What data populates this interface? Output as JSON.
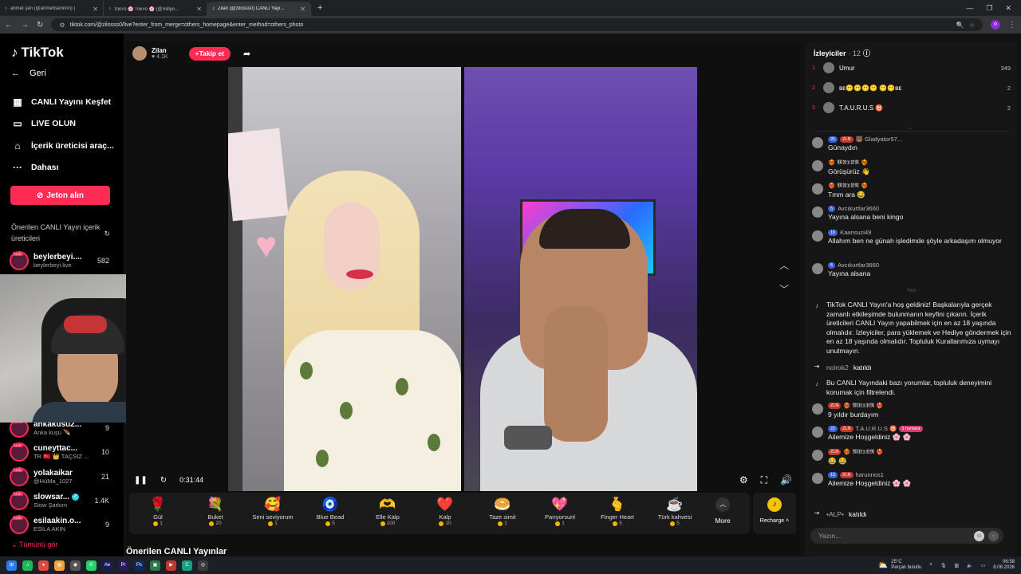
{
  "browser": {
    "tabs": [
      {
        "label": "ahmet şen (@ahmettsennnn) |",
        "active": false
      },
      {
        "label": "ᴛᴏᴋʏᴏ 🌸 ᴛᴏᴋʏᴏ 🌸 (@millyo...",
        "active": false
      },
      {
        "label": "Zilan (@zilosss0) CANLI Yayı...",
        "active": true
      }
    ],
    "url": "tiktok.com/@zilosss0/live?enter_from_merge=others_homepage&enter_method=others_photo"
  },
  "sidebar": {
    "logo": "TikTok",
    "back": "Geri",
    "nav": [
      {
        "label": "CANLI Yayını Keşfet",
        "icon": "calendar-icon"
      },
      {
        "label": "LIVE OLUN",
        "icon": "video-camera-icon"
      },
      {
        "label": "İçerik üreticisi araç...",
        "icon": "home-icon"
      },
      {
        "label": "Dahası",
        "icon": "more-dots-icon"
      }
    ],
    "coin_button": "Jeton alın",
    "suggested_title": "Önerilen CANLI Yayın içerik üreticileri",
    "creators_top": [
      {
        "name": "beylerbeyi....",
        "sub": "beylerbeyi.live",
        "count": "582"
      }
    ],
    "creators": [
      {
        "name": "ankakusu2...",
        "sub": "Anka kuşu 🪶",
        "count": "9"
      },
      {
        "name": "cuneyttac...",
        "sub": "TR 🇹🇷 👑 TAÇSIZ ...",
        "count": "10"
      },
      {
        "name": "yolakaikar",
        "sub": "@HüMa_1027",
        "count": "21"
      },
      {
        "name": "slowsar...",
        "sub": "Slow Şarkım",
        "count": "1.4K",
        "verified": true
      },
      {
        "name": "esilaakin.o...",
        "sub": "ESİLA AKIN",
        "count": "9"
      }
    ],
    "see_all": "Tümünü gör"
  },
  "stream": {
    "host_name": "Zilan",
    "host_likes": "4.1K",
    "follow": "Takip et",
    "time": "0:31:44",
    "gifts": [
      {
        "name": "Gül",
        "price": "1",
        "icon": "🌹"
      },
      {
        "name": "Buket",
        "price": "20",
        "icon": "💐"
      },
      {
        "name": "Seni seviyorum",
        "price": "1",
        "icon": "🥰"
      },
      {
        "name": "Blue Bead",
        "price": "5",
        "icon": "🧿"
      },
      {
        "name": "Elle Kalp",
        "price": "100",
        "icon": "🫶"
      },
      {
        "name": "Kalp",
        "price": "10",
        "icon": "❤️"
      },
      {
        "name": "Taze simit",
        "price": "1",
        "icon": "🥯"
      },
      {
        "name": "Parıyorsunl",
        "price": "1",
        "icon": "💖"
      },
      {
        "name": "Finger Heart",
        "price": "5",
        "icon": "🫰"
      },
      {
        "name": "Türk kahvesi",
        "price": "5",
        "icon": "☕"
      }
    ],
    "more": "More",
    "recharge": "Recharge",
    "recommended": "Önerilen CANLI Yayınlar"
  },
  "chat": {
    "viewers_label": "İzleyiciler",
    "viewers_count": "· 12",
    "top_viewers": [
      {
        "rank": "1",
        "name": "Umur",
        "value": "349"
      },
      {
        "rank": "2",
        "name": "ʙᴇ😶😶😶😶 😶😶ʙᴇ",
        "value": "2"
      },
      {
        "rank": "3",
        "name": "T.A.U.R.U.S ♉",
        "value": "2"
      }
    ],
    "messages": [
      {
        "badges": [
          {
            "t": "26",
            "c": "b-blue"
          },
          {
            "t": "ZLN",
            "c": "b-red"
          }
        ],
        "user": "🐻 Gladyator57...",
        "text": "Günaydın"
      },
      {
        "badges": [],
        "user": "❤️‍🔥 𝕸𝖀̈𝕯𝖀̈𝕽 ❤️‍🔥",
        "text": "Görüşürüz 👋"
      },
      {
        "badges": [],
        "user": "❤️‍🔥 𝕸𝖀̈𝕯𝖀̈𝕽 ❤️‍🔥",
        "text": "Tmm ara 😂"
      },
      {
        "badges": [
          {
            "t": "5",
            "c": "b-blue"
          }
        ],
        "user": "Avcıkurtlar3660",
        "text": "Yayına alsana beni kingo"
      },
      {
        "badges": [
          {
            "t": "16",
            "c": "b-blue"
          }
        ],
        "user": "Kaansuzi49",
        "text": "Allahım ben ne günah işledimde şöyle arkadaşım olmuyor"
      },
      {
        "badges": [
          {
            "t": "5",
            "c": "b-blue"
          }
        ],
        "user": "Avcıkurtlar3660",
        "text": "Yayına alsana"
      }
    ],
    "new_divider": "Yeni",
    "welcome": "TikTok CANLI Yayın'a hoş geldiniz! Başkalarıyla gerçek zamanlı etkileşimde bulunmanın keyfini çıkarın. İçerik üreticileri CANLI Yayın yapabilmek için en az 18 yaşında olmalıdır. İzleyiciler, para yüklemek ve Hediye göndermek için en az 18 yaşında olmalıdır. Topluluk Kurallarımıza uymayı unutmayın.",
    "join1_user": "noirok2",
    "joined_label": "katıldı",
    "filter_note": "Bu CANLI Yayındaki bazı yorumlar, topluluk deneyimini korumak için filtrelendi.",
    "messages2": [
      {
        "badges": [
          {
            "t": "ZLN",
            "c": "b-red"
          }
        ],
        "user": "❤️‍🔥 𝕸𝖀̈𝕯𝖀̈𝕽 ❤️‍🔥",
        "text": "9 yıldır burdayım"
      },
      {
        "badges": [
          {
            "t": "22",
            "c": "b-blue"
          },
          {
            "t": "ZLN",
            "c": "b-red"
          }
        ],
        "user": "T.A.U.R.U.S ♉",
        "extra": "3 numara",
        "text": "Ailemize Hoşgeldiniz 🌸 🌸"
      },
      {
        "badges": [
          {
            "t": "ZLN",
            "c": "b-red"
          }
        ],
        "user": "❤️‍🔥 𝕸𝖀̈𝕯𝖀̈𝕽 ❤️‍🔥",
        "text": "😂 😂"
      },
      {
        "badges": [
          {
            "t": "13",
            "c": "b-blue"
          },
          {
            "t": "ZLN",
            "c": "b-red"
          }
        ],
        "user": "harunnos1",
        "text": "Ailemize Hoşgeldiniz 🌸 🌸"
      }
    ],
    "join2_user": "•ALP•",
    "input_placeholder": "Yazın..."
  },
  "taskbar": {
    "temp": "25°C",
    "weather": "Parçalı bulutlu",
    "time": "06:58",
    "date": "8.08.2026"
  },
  "colors": {
    "accent": "#fe2c55",
    "coin": "#f5b400"
  }
}
